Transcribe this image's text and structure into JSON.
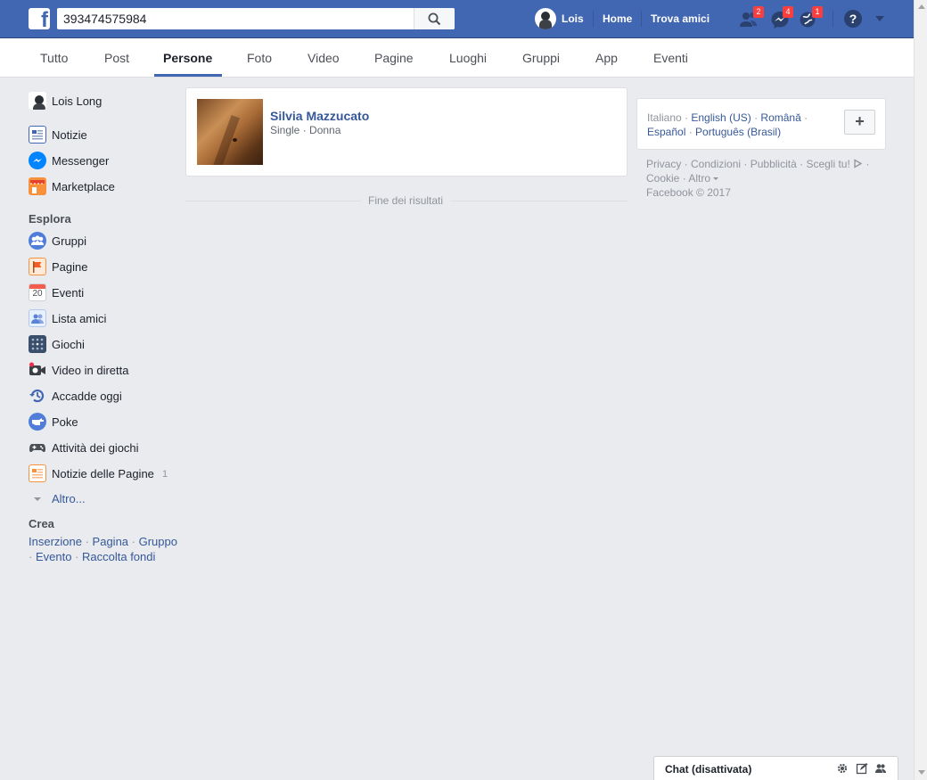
{
  "topbar": {
    "search_value": "393474575984",
    "user_name": "Lois",
    "home_label": "Home",
    "find_friends_label": "Trova amici",
    "friend_requests_count": "2",
    "messages_count": "4",
    "notifications_count": "1",
    "brand_color": "#4267b2"
  },
  "tabs": [
    {
      "label": "Tutto"
    },
    {
      "label": "Post"
    },
    {
      "label": "Persone"
    },
    {
      "label": "Foto"
    },
    {
      "label": "Video"
    },
    {
      "label": "Pagine"
    },
    {
      "label": "Luoghi"
    },
    {
      "label": "Gruppi"
    },
    {
      "label": "App"
    },
    {
      "label": "Eventi"
    }
  ],
  "active_tab": "Persone",
  "sidebar": {
    "profile_name": "Lois Long",
    "items": [
      {
        "label": "Notizie",
        "icon": "news-feed-icon"
      },
      {
        "label": "Messenger",
        "icon": "messenger-icon"
      },
      {
        "label": "Marketplace",
        "icon": "marketplace-icon"
      }
    ],
    "explore_title": "Esplora",
    "explore_items": [
      {
        "label": "Gruppi",
        "icon": "groups-icon"
      },
      {
        "label": "Pagine",
        "icon": "pages-flag-icon"
      },
      {
        "label": "Eventi",
        "icon": "calendar-icon",
        "icon_text": "20"
      },
      {
        "label": "Lista amici",
        "icon": "friend-list-icon"
      },
      {
        "label": "Giochi",
        "icon": "games-icon"
      },
      {
        "label": "Video in diretta",
        "icon": "live-video-icon"
      },
      {
        "label": "Accadde oggi",
        "icon": "on-this-day-icon"
      },
      {
        "label": "Poke",
        "icon": "poke-icon"
      },
      {
        "label": "Attività dei giochi",
        "icon": "gamepad-icon"
      },
      {
        "label": "Notizie delle Pagine",
        "icon": "pages-feed-icon",
        "count": "1"
      }
    ],
    "more_label": "Altro...",
    "create_title": "Crea",
    "create_links": [
      "Inserzione",
      "Pagina",
      "Gruppo",
      "Evento",
      "Raccolta fondi"
    ]
  },
  "results": [
    {
      "name": "Silvia Mazzucato",
      "meta": "Single · Donna"
    }
  ],
  "end_of_results": "Fine dei risultati",
  "languages": {
    "current": "Italiano",
    "links": [
      "English (US)",
      "Română",
      "Español",
      "Português (Brasil)"
    ],
    "add_label": "+"
  },
  "footer": {
    "links": [
      "Privacy",
      "Condizioni",
      "Pubblicità",
      "Scegli tu!",
      "Cookie",
      "Altro"
    ],
    "copyright": "Facebook © 2017"
  },
  "chat": {
    "label": "Chat (disattivata)"
  }
}
